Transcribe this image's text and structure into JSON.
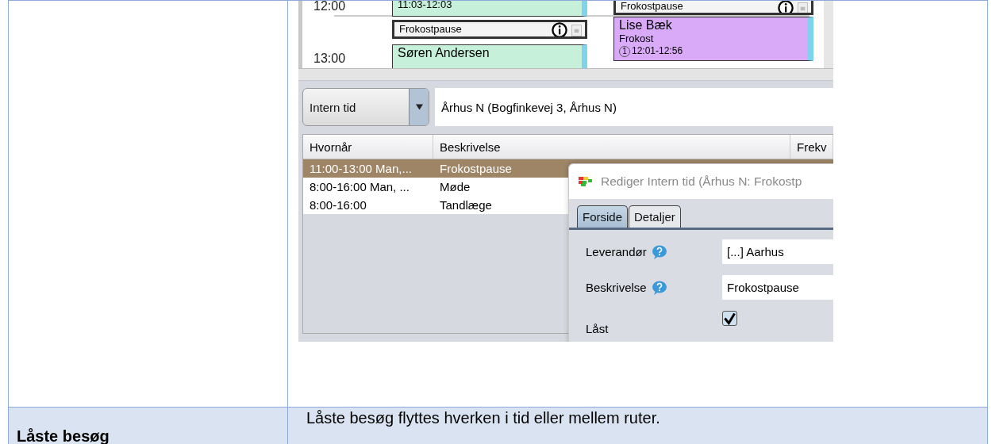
{
  "calendar": {
    "times": [
      "12:00",
      "13:00"
    ],
    "events": [
      {
        "kind": "appointment",
        "color": "#c6f0da",
        "lines": [
          "11:03-12:03"
        ]
      },
      {
        "kind": "break",
        "color": "#f4f4f4",
        "lines": [
          "Frokostpause"
        ]
      },
      {
        "kind": "appointment",
        "color": "#c6f0da",
        "lines": [
          "Søren Andersen"
        ]
      },
      {
        "kind": "break",
        "color": "#f4f4f4",
        "lines": [
          "Frokostpause"
        ]
      },
      {
        "kind": "appointment",
        "color": "#d9aaf8",
        "lines": [
          "Lise Bæk",
          "Frokost",
          "12:01-12:56"
        ],
        "badge": "1"
      }
    ]
  },
  "filter": {
    "type": "Intern tid",
    "location": "Århus N (Bogfinkevej 3, Århus N)"
  },
  "table": {
    "columns": [
      "Hvornår",
      "Beskrivelse",
      "Frekv"
    ],
    "rows": [
      {
        "cells": [
          "11:00-13:00 Man,...",
          "Frokostpause"
        ],
        "selected": true
      },
      {
        "cells": [
          "8:00-16:00 Man, ...",
          "Møde"
        ],
        "selected": false
      },
      {
        "cells": [
          "8:00-16:00",
          "Tandlæge"
        ],
        "selected": false
      }
    ]
  },
  "dialog": {
    "title": "Rediger Intern tid (Århus N: Frokostp",
    "tabs": [
      {
        "label": "Forside",
        "selected": true
      },
      {
        "label": "Detaljer",
        "selected": false
      }
    ],
    "fields": [
      {
        "kind": "text",
        "label": "Leverandør",
        "value": "[...] Aarhus",
        "help": true
      },
      {
        "kind": "text",
        "label": "Beskrivelse",
        "value": "Frokostpause",
        "help": true
      },
      {
        "kind": "checkbox",
        "label": "Låst",
        "checked": true,
        "help": false
      }
    ]
  },
  "doc_table": {
    "rows": [
      {
        "heading": "Låste besøg",
        "text": "Låste besøg flyttes hverken i tid eller mellem ruter."
      }
    ]
  }
}
